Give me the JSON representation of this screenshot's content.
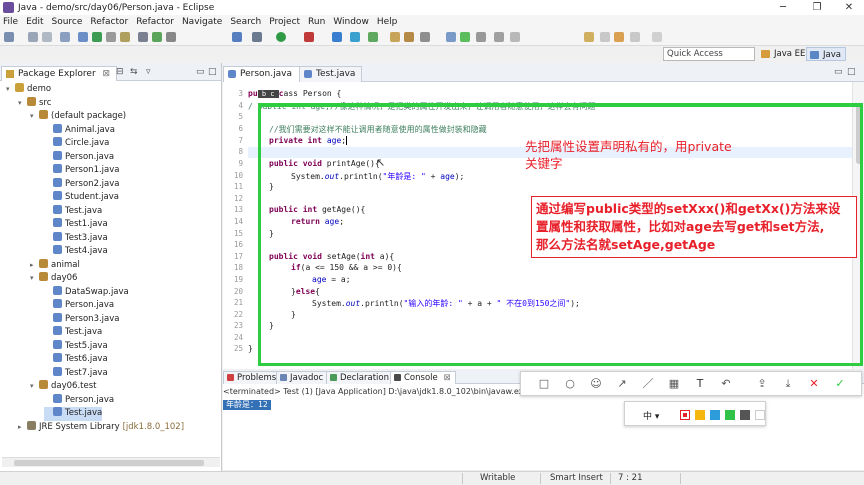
{
  "window": {
    "title": "Java - demo/src/day06/Person.java - Eclipse"
  },
  "menu": [
    "File",
    "Edit",
    "Source",
    "Refactor",
    "Refactor",
    "Navigate",
    "Search",
    "Project",
    "Run",
    "Window",
    "Help"
  ],
  "quick_access": {
    "placeholder": "Quick Access"
  },
  "perspectives": [
    "Java EE",
    "Java"
  ],
  "package_explorer": {
    "tab": "Package Explorer",
    "items": [
      {
        "label": "demo",
        "level": 0,
        "icon": "project-icon",
        "expanded": true
      },
      {
        "label": "src",
        "level": 1,
        "icon": "source-folder-icon",
        "expanded": true
      },
      {
        "label": "(default package)",
        "level": 2,
        "icon": "package-icon",
        "expanded": true
      },
      {
        "label": "Animal.java",
        "level": 3,
        "icon": "java-file-icon"
      },
      {
        "label": "Circle.java",
        "level": 3,
        "icon": "java-file-icon"
      },
      {
        "label": "Person.java",
        "level": 3,
        "icon": "java-file-icon"
      },
      {
        "label": "Person1.java",
        "level": 3,
        "icon": "java-file-icon"
      },
      {
        "label": "Person2.java",
        "level": 3,
        "icon": "java-file-icon"
      },
      {
        "label": "Student.java",
        "level": 3,
        "icon": "java-file-icon"
      },
      {
        "label": "Test.java",
        "level": 3,
        "icon": "java-file-icon"
      },
      {
        "label": "Test1.java",
        "level": 3,
        "icon": "java-file-icon"
      },
      {
        "label": "Test3.java",
        "level": 3,
        "icon": "java-file-icon"
      },
      {
        "label": "Test4.java",
        "level": 3,
        "icon": "java-file-icon"
      },
      {
        "label": "animal",
        "level": 2,
        "icon": "package-icon",
        "expanded": false
      },
      {
        "label": "day06",
        "level": 2,
        "icon": "package-icon",
        "expanded": true
      },
      {
        "label": "DataSwap.java",
        "level": 3,
        "icon": "java-file-icon"
      },
      {
        "label": "Person.java",
        "level": 3,
        "icon": "java-file-icon"
      },
      {
        "label": "Person3.java",
        "level": 3,
        "icon": "java-file-icon"
      },
      {
        "label": "Test.java",
        "level": 3,
        "icon": "java-file-icon"
      },
      {
        "label": "Test5.java",
        "level": 3,
        "icon": "java-file-icon"
      },
      {
        "label": "Test6.java",
        "level": 3,
        "icon": "java-file-icon"
      },
      {
        "label": "Test7.java",
        "level": 3,
        "icon": "java-file-icon"
      },
      {
        "label": "day06.test",
        "level": 2,
        "icon": "package-icon",
        "expanded": true
      },
      {
        "label": "Person.java",
        "level": 3,
        "icon": "java-file-icon"
      },
      {
        "label": "Test.java",
        "level": 3,
        "icon": "java-file-icon",
        "selected": true
      },
      {
        "label": "JRE System Library",
        "suffix": "[jdk1.8.0_102]",
        "level": 1,
        "icon": "library-icon",
        "expanded": false
      }
    ]
  },
  "editor": {
    "tabs": [
      {
        "label": "Person.java",
        "active": true
      },
      {
        "label": "Test.java",
        "active": false
      }
    ],
    "line_numbers": [
      "3",
      "4",
      "5",
      "6",
      "7",
      "8",
      "9",
      "10",
      "11",
      "12",
      "13",
      "14",
      "15",
      "16",
      "17",
      "18",
      "19",
      "20",
      "21",
      "22",
      "23",
      "24",
      "25"
    ]
  },
  "annotations": {
    "note1_line1": "先把属性设置声明私有的，用private",
    "note1_line2": "关键字",
    "note2_line1": "通过编写public类型的setXxx()和getXx()方法来设",
    "note2_line2": "置属性和获取属性，比如对age去写get和set方法,",
    "note2_line3": "那么方法名就setAge,getAge"
  },
  "console": {
    "tabs": [
      "Problems",
      "Javadoc",
      "Declaration",
      "Console"
    ],
    "terminated": "<terminated> Test (1) [Java Application] D:\\java\\jdk1.8.0_102\\bin\\javaw.exe (",
    "output": "年龄是：12"
  },
  "color_panel": {
    "size_label": "中",
    "colors": [
      "#e8202a",
      "#f5b70f",
      "#2d9cdb",
      "#31c24a",
      "#555555",
      "#ffffff"
    ]
  },
  "status": {
    "mode": "Writable",
    "insert": "Smart Insert",
    "position": "7 : 21"
  }
}
